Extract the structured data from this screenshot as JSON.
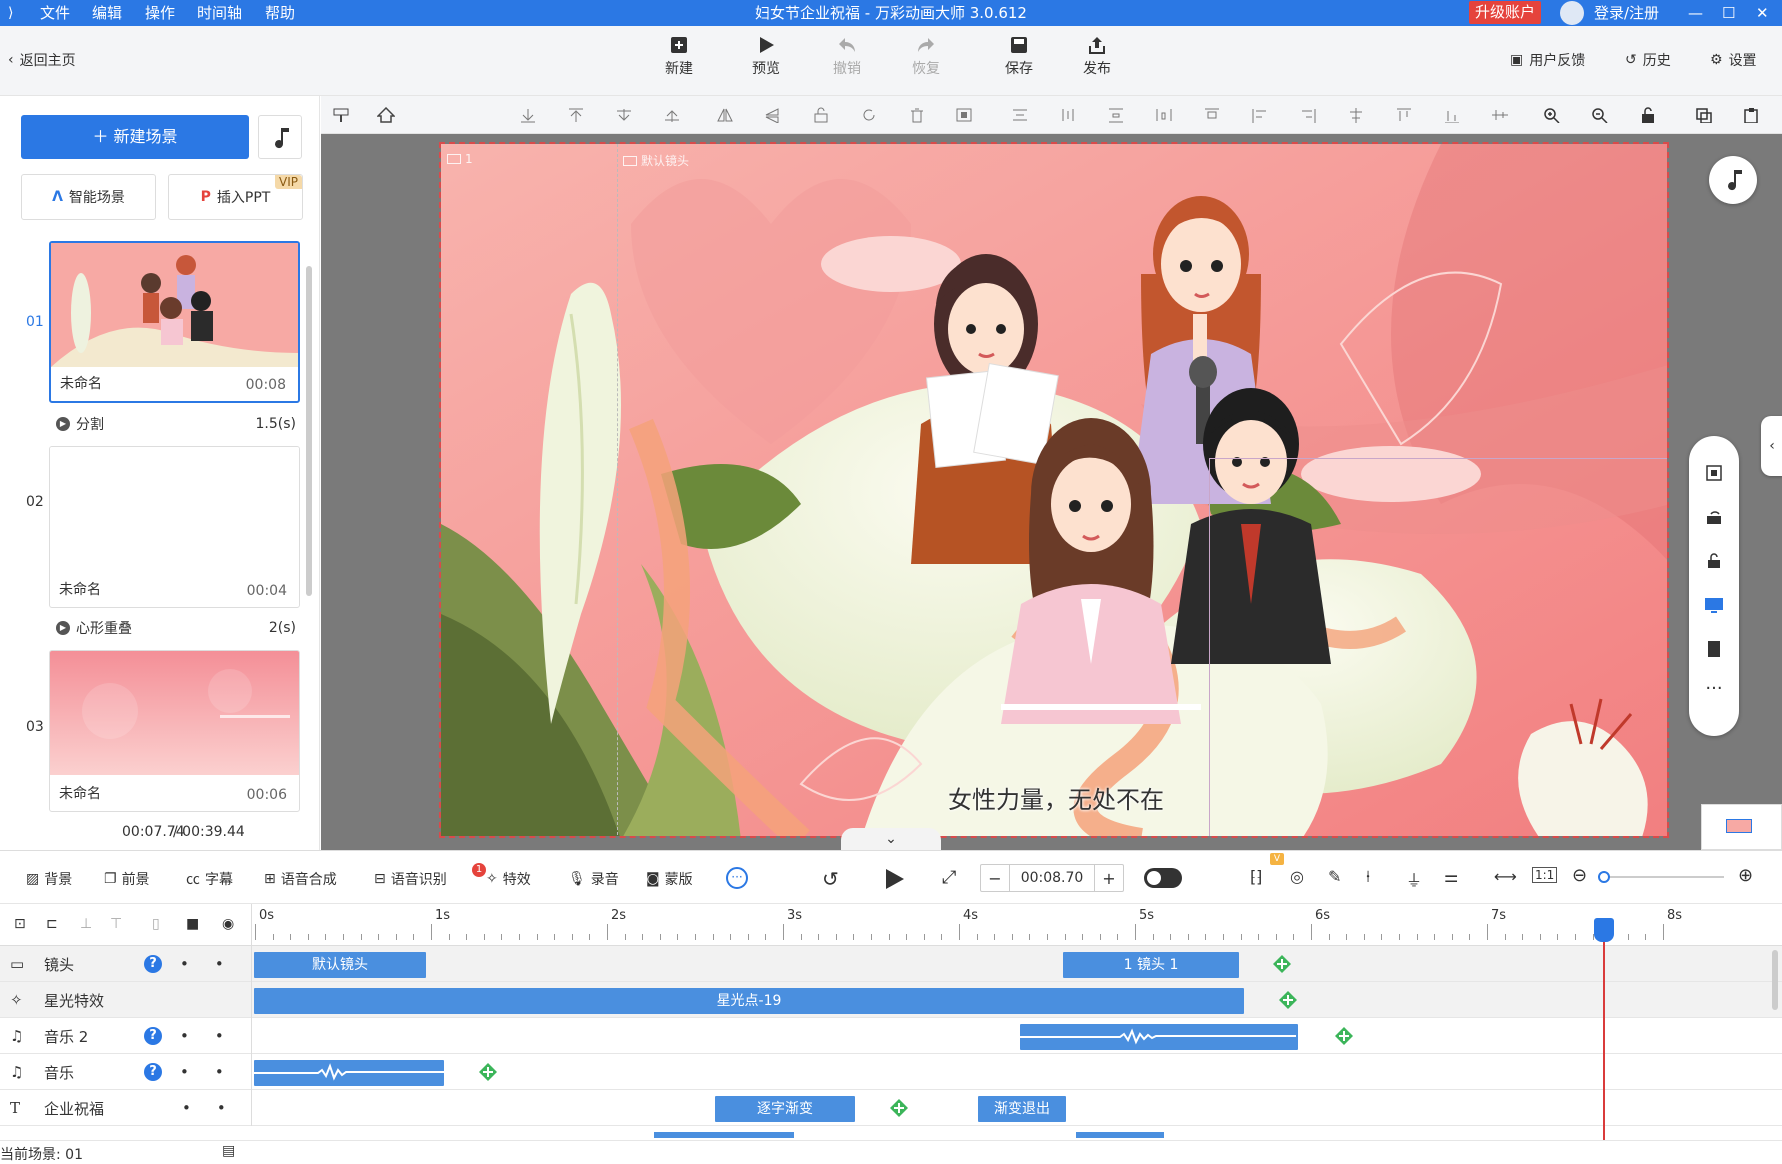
{
  "titlebar": {
    "menu": [
      "文件",
      "编辑",
      "操作",
      "时间轴",
      "帮助"
    ],
    "title": "妇女节企业祝福 - 万彩动画大师 3.0.612",
    "upgrade": "升级账户",
    "login": "登录/注册"
  },
  "toolbar": {
    "back": "返回主页",
    "new": "新建",
    "preview": "预览",
    "undo": "撤销",
    "redo": "恢复",
    "save": "保存",
    "publish": "发布",
    "feedback": "用户反馈",
    "history": "历史",
    "settings": "设置"
  },
  "left": {
    "new_scene": "新建场景",
    "smart_scene": "智能场景",
    "insert_ppt": "插入PPT",
    "vip": "VIP",
    "scenes": [
      {
        "num": "01",
        "name": "未命名",
        "duration": "00:08"
      },
      {
        "num": "02",
        "name": "未命名",
        "duration": "00:04"
      },
      {
        "num": "03",
        "name": "未命名",
        "duration": "00:06"
      }
    ],
    "transitions": [
      {
        "name": "分割",
        "duration": "1.5(s)"
      },
      {
        "name": "心形重叠",
        "duration": "2(s)"
      }
    ],
    "current_time": "00:07.74",
    "total_time": "/ 00:39.44"
  },
  "stage": {
    "label_1": "1",
    "label_default": "默认镜头",
    "subtitle": "女性力量，无处不在"
  },
  "timeline_toolbar": {
    "background": "背景",
    "foreground": "前景",
    "caption": "字幕",
    "tts": "语音合成",
    "asr": "语音识别",
    "asr_badge": "1",
    "effects": "特效",
    "record": "录音",
    "mask": "蒙版",
    "time_value": "00:08.70",
    "v_badge": "V"
  },
  "ruler": [
    "0s",
    "1s",
    "2s",
    "3s",
    "4s",
    "5s",
    "6s",
    "7s",
    "8s"
  ],
  "tracks": [
    {
      "label": "镜头",
      "clips": [
        "默认镜头",
        "1 镜头 1"
      ]
    },
    {
      "label": "星光特效",
      "clips": [
        "星光点-19"
      ]
    },
    {
      "label": "音乐 2",
      "clips": []
    },
    {
      "label": "音乐",
      "clips": []
    },
    {
      "label": "企业祝福",
      "clips": [
        "逐字渐变",
        "渐变退出"
      ]
    }
  ],
  "status": {
    "current_scene": "当前场景: 01"
  },
  "colors": {
    "primary": "#2b78e4",
    "clip": "#4a8fdf",
    "danger": "#e5433c",
    "canvas_bg": "#f7a9a4"
  }
}
